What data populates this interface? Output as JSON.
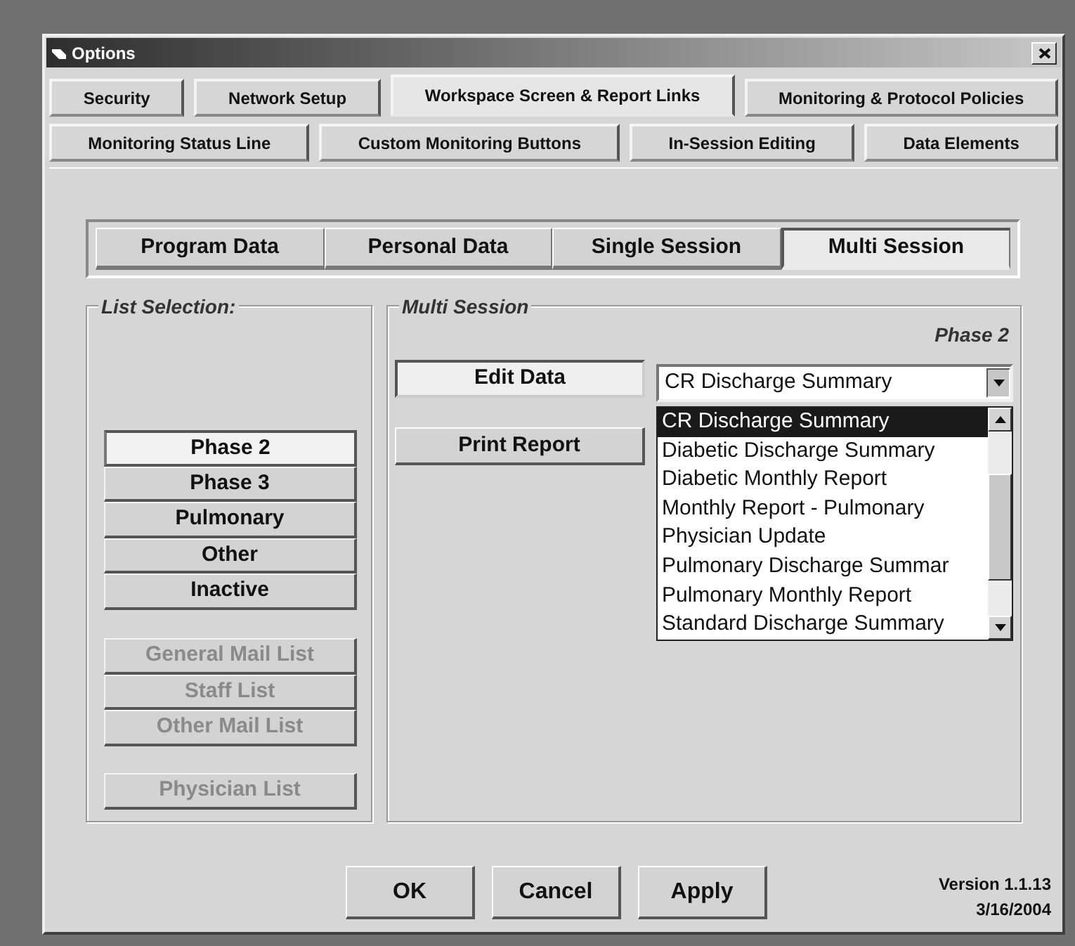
{
  "window": {
    "title": "Options"
  },
  "tab_rows": [
    [
      {
        "label": "Security",
        "selected": false
      },
      {
        "label": "Network Setup",
        "selected": false
      },
      {
        "label": "Workspace Screen & Report Links",
        "selected": true
      },
      {
        "label": "Monitoring & Protocol Policies",
        "selected": false
      }
    ],
    [
      {
        "label": "Monitoring Status Line",
        "selected": false
      },
      {
        "label": "Custom Monitoring Buttons",
        "selected": false
      },
      {
        "label": "In-Session Editing",
        "selected": false
      },
      {
        "label": "Data Elements",
        "selected": false
      }
    ]
  ],
  "sub_tabs": [
    {
      "label": "Program Data",
      "selected": false
    },
    {
      "label": "Personal Data",
      "selected": false
    },
    {
      "label": "Single Session",
      "selected": false
    },
    {
      "label": "Multi Session",
      "selected": true
    }
  ],
  "list_selection": {
    "title": "List Selection:",
    "groups": [
      [
        {
          "label": "Phase 2",
          "selected": true,
          "disabled": false
        },
        {
          "label": "Phase 3",
          "selected": false,
          "disabled": false
        },
        {
          "label": "Pulmonary",
          "selected": false,
          "disabled": false
        },
        {
          "label": "Other",
          "selected": false,
          "disabled": false
        },
        {
          "label": "Inactive",
          "selected": false,
          "disabled": false
        }
      ],
      [
        {
          "label": "General Mail List",
          "selected": false,
          "disabled": true
        },
        {
          "label": "Staff List",
          "selected": false,
          "disabled": true
        },
        {
          "label": "Other Mail List",
          "selected": false,
          "disabled": true
        }
      ],
      [
        {
          "label": "Physician List",
          "selected": false,
          "disabled": true
        }
      ]
    ]
  },
  "multi_session": {
    "title": "Multi Session",
    "phase_label": "Phase 2",
    "buttons": [
      {
        "label": "Edit Data",
        "pressed": true
      },
      {
        "label": "Print Report",
        "pressed": false
      }
    ],
    "report_combo": {
      "value": "CR Discharge Summary",
      "expanded": true,
      "options": [
        {
          "label": "CR Discharge Summary",
          "selected": true
        },
        {
          "label": "Diabetic Discharge Summary",
          "selected": false
        },
        {
          "label": "Diabetic Monthly Report",
          "selected": false
        },
        {
          "label": "Monthly Report - Pulmonary",
          "selected": false
        },
        {
          "label": "Physician Update",
          "selected": false
        },
        {
          "label": "Pulmonary Discharge Summar",
          "selected": false
        },
        {
          "label": "Pulmonary Monthly Report",
          "selected": false
        },
        {
          "label": "Standard Discharge Summary",
          "selected": false
        }
      ]
    }
  },
  "buttons": [
    "OK",
    "Cancel",
    "Apply"
  ],
  "version": "Version 1.1.13",
  "date": "3/16/2004"
}
